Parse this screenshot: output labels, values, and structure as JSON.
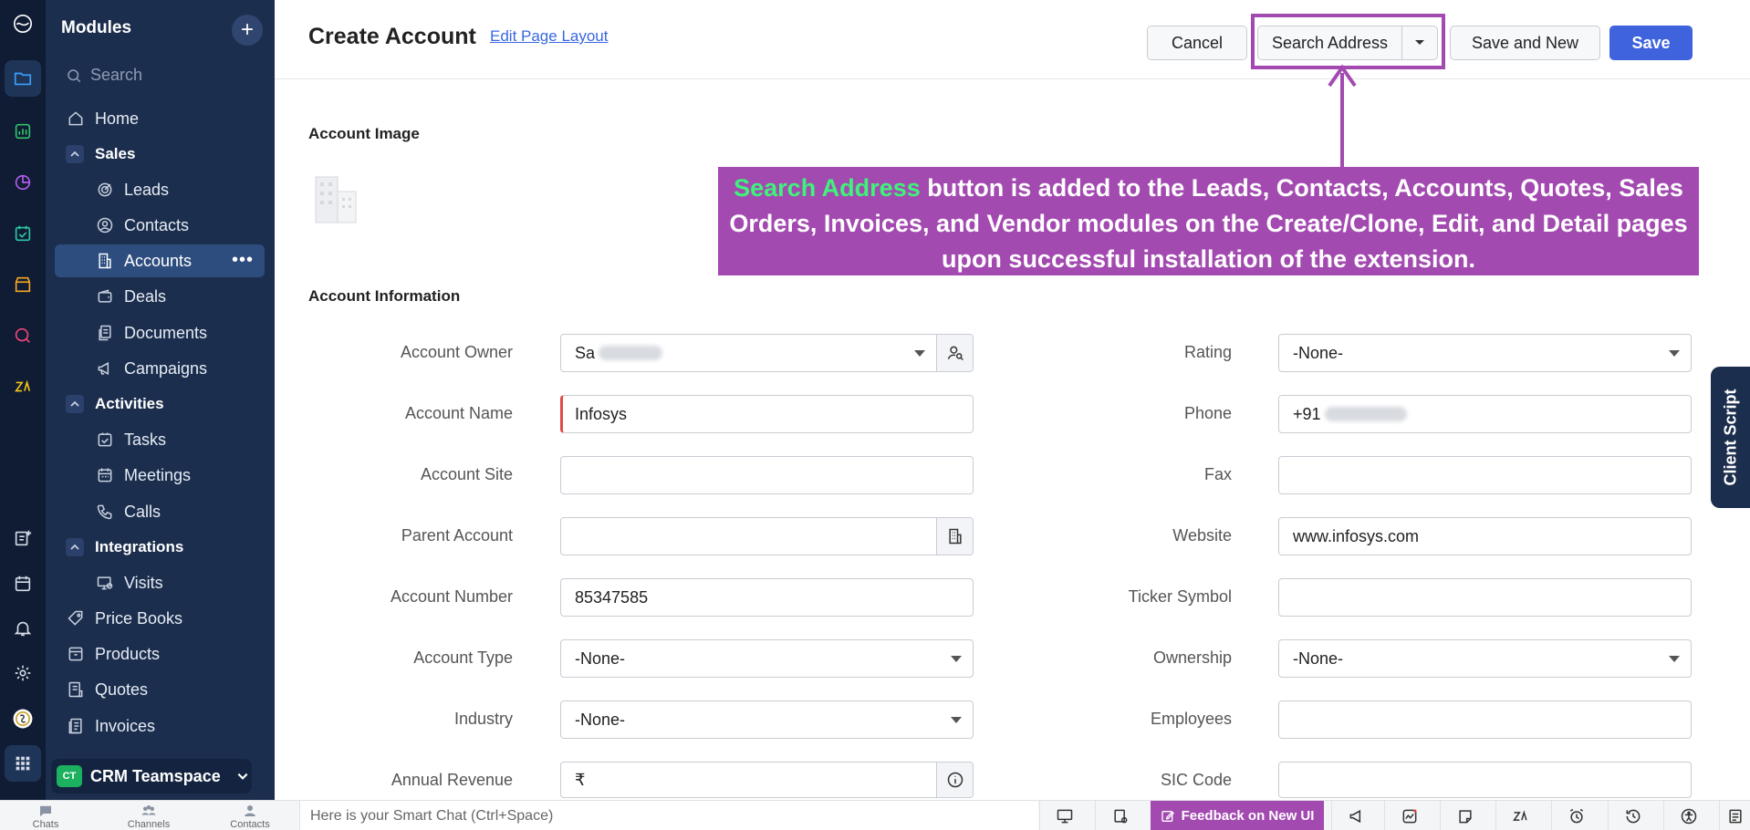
{
  "sidebar": {
    "title": "Modules",
    "search_placeholder": "Search",
    "items": [
      {
        "label": "Home"
      },
      {
        "label": "Sales"
      },
      {
        "label": "Leads"
      },
      {
        "label": "Contacts"
      },
      {
        "label": "Accounts"
      },
      {
        "label": "Deals"
      },
      {
        "label": "Documents"
      },
      {
        "label": "Campaigns"
      },
      {
        "label": "Activities"
      },
      {
        "label": "Tasks"
      },
      {
        "label": "Meetings"
      },
      {
        "label": "Calls"
      },
      {
        "label": "Integrations"
      },
      {
        "label": "Visits"
      },
      {
        "label": "Price Books"
      },
      {
        "label": "Products"
      },
      {
        "label": "Quotes"
      },
      {
        "label": "Invoices"
      }
    ],
    "teamspace": {
      "badge": "CT",
      "label": "CRM Teamspace"
    }
  },
  "header": {
    "title": "Create Account",
    "edit_layout": "Edit Page Layout",
    "cancel": "Cancel",
    "search_address": "Search Address",
    "save_new": "Save and New",
    "save": "Save"
  },
  "callout": {
    "highlight": "Search Address",
    "text": " button is added to the Leads, Contacts, Accounts, Quotes, Sales Orders, Invoices, and Vendor modules on the Create/Clone, Edit, and Detail pages upon successful installation of the extension."
  },
  "sections": {
    "image": "Account Image",
    "info": "Account Information"
  },
  "form": {
    "left": [
      {
        "label": "Account Owner",
        "value": "Sa"
      },
      {
        "label": "Account Name",
        "value": "Infosys"
      },
      {
        "label": "Account Site",
        "value": ""
      },
      {
        "label": "Parent Account",
        "value": ""
      },
      {
        "label": "Account Number",
        "value": "85347585"
      },
      {
        "label": "Account Type",
        "value": "-None-"
      },
      {
        "label": "Industry",
        "value": "-None-"
      },
      {
        "label": "Annual Revenue",
        "value": "₹"
      }
    ],
    "right": [
      {
        "label": "Rating",
        "value": "-None-"
      },
      {
        "label": "Phone",
        "value": "+91"
      },
      {
        "label": "Fax",
        "value": ""
      },
      {
        "label": "Website",
        "value": "www.infosys.com"
      },
      {
        "label": "Ticker Symbol",
        "value": ""
      },
      {
        "label": "Ownership",
        "value": "-None-"
      },
      {
        "label": "Employees",
        "value": ""
      },
      {
        "label": "SIC Code",
        "value": ""
      }
    ]
  },
  "client_script": "Client Script",
  "bottom": {
    "chats": "Chats",
    "channels": "Channels",
    "contacts": "Contacts",
    "smartchat": "Here is your Smart Chat (Ctrl+Space)",
    "feedback": "Feedback on New UI"
  },
  "colors": {
    "rail": "#0f1c33",
    "sidebar": "#1c2e4d",
    "accent": "#3f63dd",
    "highlight": "#a34ab1",
    "callout_highlight": "#3ff27a"
  }
}
